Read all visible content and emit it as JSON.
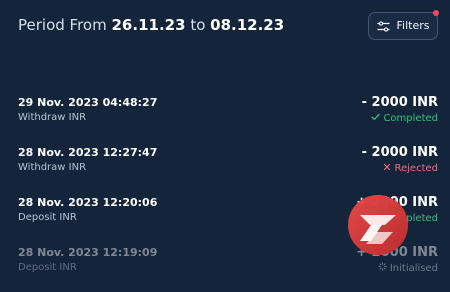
{
  "header": {
    "prefix": "Period From",
    "from_date": "26.11.23",
    "connector": "to",
    "to_date": "08.12.23",
    "filters_label": "Filters",
    "filters_icon": "sliders-icon",
    "notification_dot_color": "#f24a5a"
  },
  "transactions": [
    {
      "datetime": "29 Nov. 2023 04:48:27",
      "type": "Withdraw INR",
      "amount": "- 2000 INR",
      "status": "Completed",
      "status_icon": "check-icon",
      "status_color": "#33c07b"
    },
    {
      "datetime": "28 Nov. 2023 12:27:47",
      "type": "Withdraw INR",
      "amount": "- 2000 INR",
      "status": "Rejected",
      "status_icon": "x-icon",
      "status_color": "#f16b7d"
    },
    {
      "datetime": "28 Nov. 2023 12:20:06",
      "type": "Deposit INR",
      "amount": "+ 2000 INR",
      "status": "Completed",
      "status_icon": "check-icon",
      "status_color": "#33c07b"
    },
    {
      "datetime": "28 Nov. 2023 12:19:09",
      "type": "Deposit INR",
      "amount": "+ 2000 INR",
      "status": "Initialised",
      "status_icon": "loading-icon",
      "status_color": "#d7dfeb"
    }
  ],
  "theme": {
    "background": "#14243b",
    "button_border": "#44556e",
    "watermark_color": "#d63838"
  }
}
